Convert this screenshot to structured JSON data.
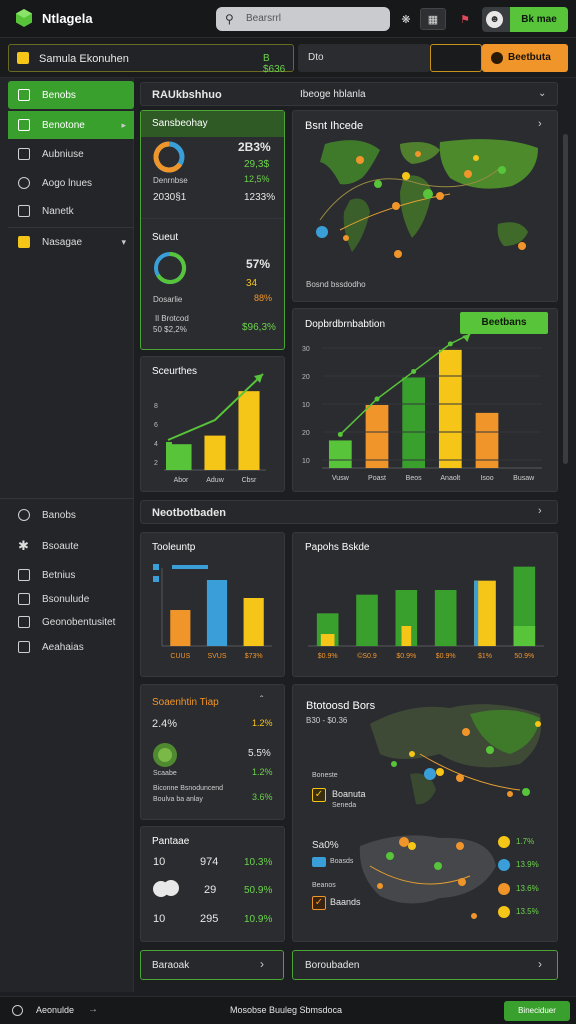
{
  "app": {
    "name": "Ntlagela",
    "search_placeholder": "Bearsrrl",
    "user_button": "Bk mae"
  },
  "project": {
    "label": "Samula Ekonuhen",
    "value": "B $636",
    "select": "Dto",
    "action": "Beetbuta"
  },
  "sidebar": {
    "items": [
      {
        "label": "Benobs",
        "icon": "chart-icon"
      },
      {
        "label": "Benotone",
        "icon": "layers-icon"
      },
      {
        "label": "Aubniuse",
        "icon": "pen-icon"
      },
      {
        "label": "Aogo lnues",
        "icon": "clock-icon"
      },
      {
        "label": "Nanetk",
        "icon": "folder-icon"
      },
      {
        "label": "Nasagae",
        "icon": "tag-icon"
      }
    ],
    "lower_items": [
      {
        "label": "Banobs",
        "icon": "search-icon"
      },
      {
        "label": "Bsoaute",
        "icon": "gear-icon"
      },
      {
        "label": "Betnius",
        "icon": "lock-icon"
      },
      {
        "label": "Bsonulude",
        "icon": "edit-icon"
      },
      {
        "label": "Geonobentusitet",
        "icon": "grid-icon"
      },
      {
        "label": "Aeahaias",
        "icon": "home-icon"
      }
    ]
  },
  "section1": {
    "title": "RAUkbshhuo",
    "title2": "Ibeoge hblanla"
  },
  "card_a": {
    "title": "Sansbeohay",
    "big": "2B3%",
    "v2": "29,3$",
    "v3": "12,5%",
    "v4": "2030§1",
    "v5": "1233%",
    "lbl": "Denrnbse"
  },
  "card_b": {
    "title": "Sueut",
    "v1": "57%",
    "v2": "34",
    "v3": "88%",
    "lbl": "Dosarlie",
    "note1": "Il Brotcod",
    "note2": "50 $2,2%",
    "note3": "$96,3%"
  },
  "map1": {
    "title": "Bsnt Ihcede",
    "caption": "Bosnd bssdodho"
  },
  "card_c": {
    "title": "Sceurthes",
    "cats": [
      "Abor",
      "Aduw",
      "Cbsr"
    ]
  },
  "combo": {
    "title": "Dopbrdbrnbabtion",
    "badge": "Beetbans",
    "yticks": [
      "30",
      "20",
      "10",
      "20",
      "10"
    ],
    "cats": [
      "Vusw",
      "Poast",
      "Beos",
      "Anaolt",
      "Isoo",
      "Busaw"
    ]
  },
  "section2": {
    "title": "Neotbotbaden"
  },
  "chart_data": [
    {
      "type": "bar",
      "title": "Sceurthes",
      "categories": [
        "Abor",
        "Aduw",
        "Cbsr"
      ],
      "values": [
        18,
        24,
        55
      ],
      "colors": [
        "#57c43a",
        "#f5c518",
        "#f5c518"
      ]
    },
    {
      "type": "bar",
      "title": "Dopbrdbrnbabtion",
      "categories": [
        "Vusw",
        "Poast",
        "Beos",
        "Anaolt",
        "Isoo",
        "Busaw"
      ],
      "values": [
        7,
        16,
        23,
        30,
        14,
        0
      ],
      "yticks": [
        "30",
        "20",
        "10",
        "20",
        "10"
      ],
      "colors": [
        "#57c43a",
        "#f0952a",
        "#3aa02d",
        "#f5c518",
        "#f0952a",
        "#3aa02d"
      ]
    },
    {
      "type": "bar",
      "title": "Tooleuntp",
      "categories": [
        "CUUS",
        "SVUS",
        "$73%"
      ],
      "values": [
        6,
        11,
        8
      ],
      "colors": [
        "#f0952a",
        "#3a9fd8",
        "#f5c518"
      ]
    },
    {
      "type": "bar",
      "title": "Papohs Bskde",
      "categories": [
        "$0.9%",
        "©S0.9",
        "$0.9%",
        "$0.9%",
        "$1%",
        "50.9%"
      ],
      "values": [
        7,
        11,
        12,
        12,
        14,
        17
      ],
      "colors": [
        "#3aa02d",
        "#3aa02d",
        "#3aa02d",
        "#3aa02d",
        "#f5c518",
        "#3aa02d"
      ]
    }
  ],
  "bottom": {
    "card_d": {
      "title": "Soaenhtin Tiap",
      "v1": "2.4%",
      "v2": "1.2%",
      "v3": "5.5%",
      "v4": "3.6%",
      "lbl1": "Scaabe",
      "line1": "Biconne Bsnoduncend",
      "line2": "Boulva ba anlay"
    },
    "card_e": {
      "title": "Pantaae",
      "rows": [
        {
          "a": "10",
          "b": "974",
          "c": "10.3%"
        },
        {
          "a": "",
          "b": "29",
          "c": "50.9%"
        },
        {
          "a": "10",
          "b": "295",
          "c": "10.9%"
        }
      ]
    },
    "map2": {
      "title": "Btotoosd Bors",
      "sub": "B30 - $0.36",
      "legend": [
        "Boneste",
        "Boanuta",
        "Seneda",
        "Baands"
      ],
      "stat": "Sa0%",
      "c1": "Boasds",
      "c2": "Beanos",
      "pcts": [
        "1.7%",
        "13.9%",
        "13.6%",
        "13.5%"
      ]
    },
    "bar1": "Baraoak",
    "bar2": "Boroubaden"
  },
  "footer": {
    "left": "Aeonulde",
    "center": "Mosobse Buuleg Sbmsdoca",
    "cta": "Bineciduer"
  }
}
